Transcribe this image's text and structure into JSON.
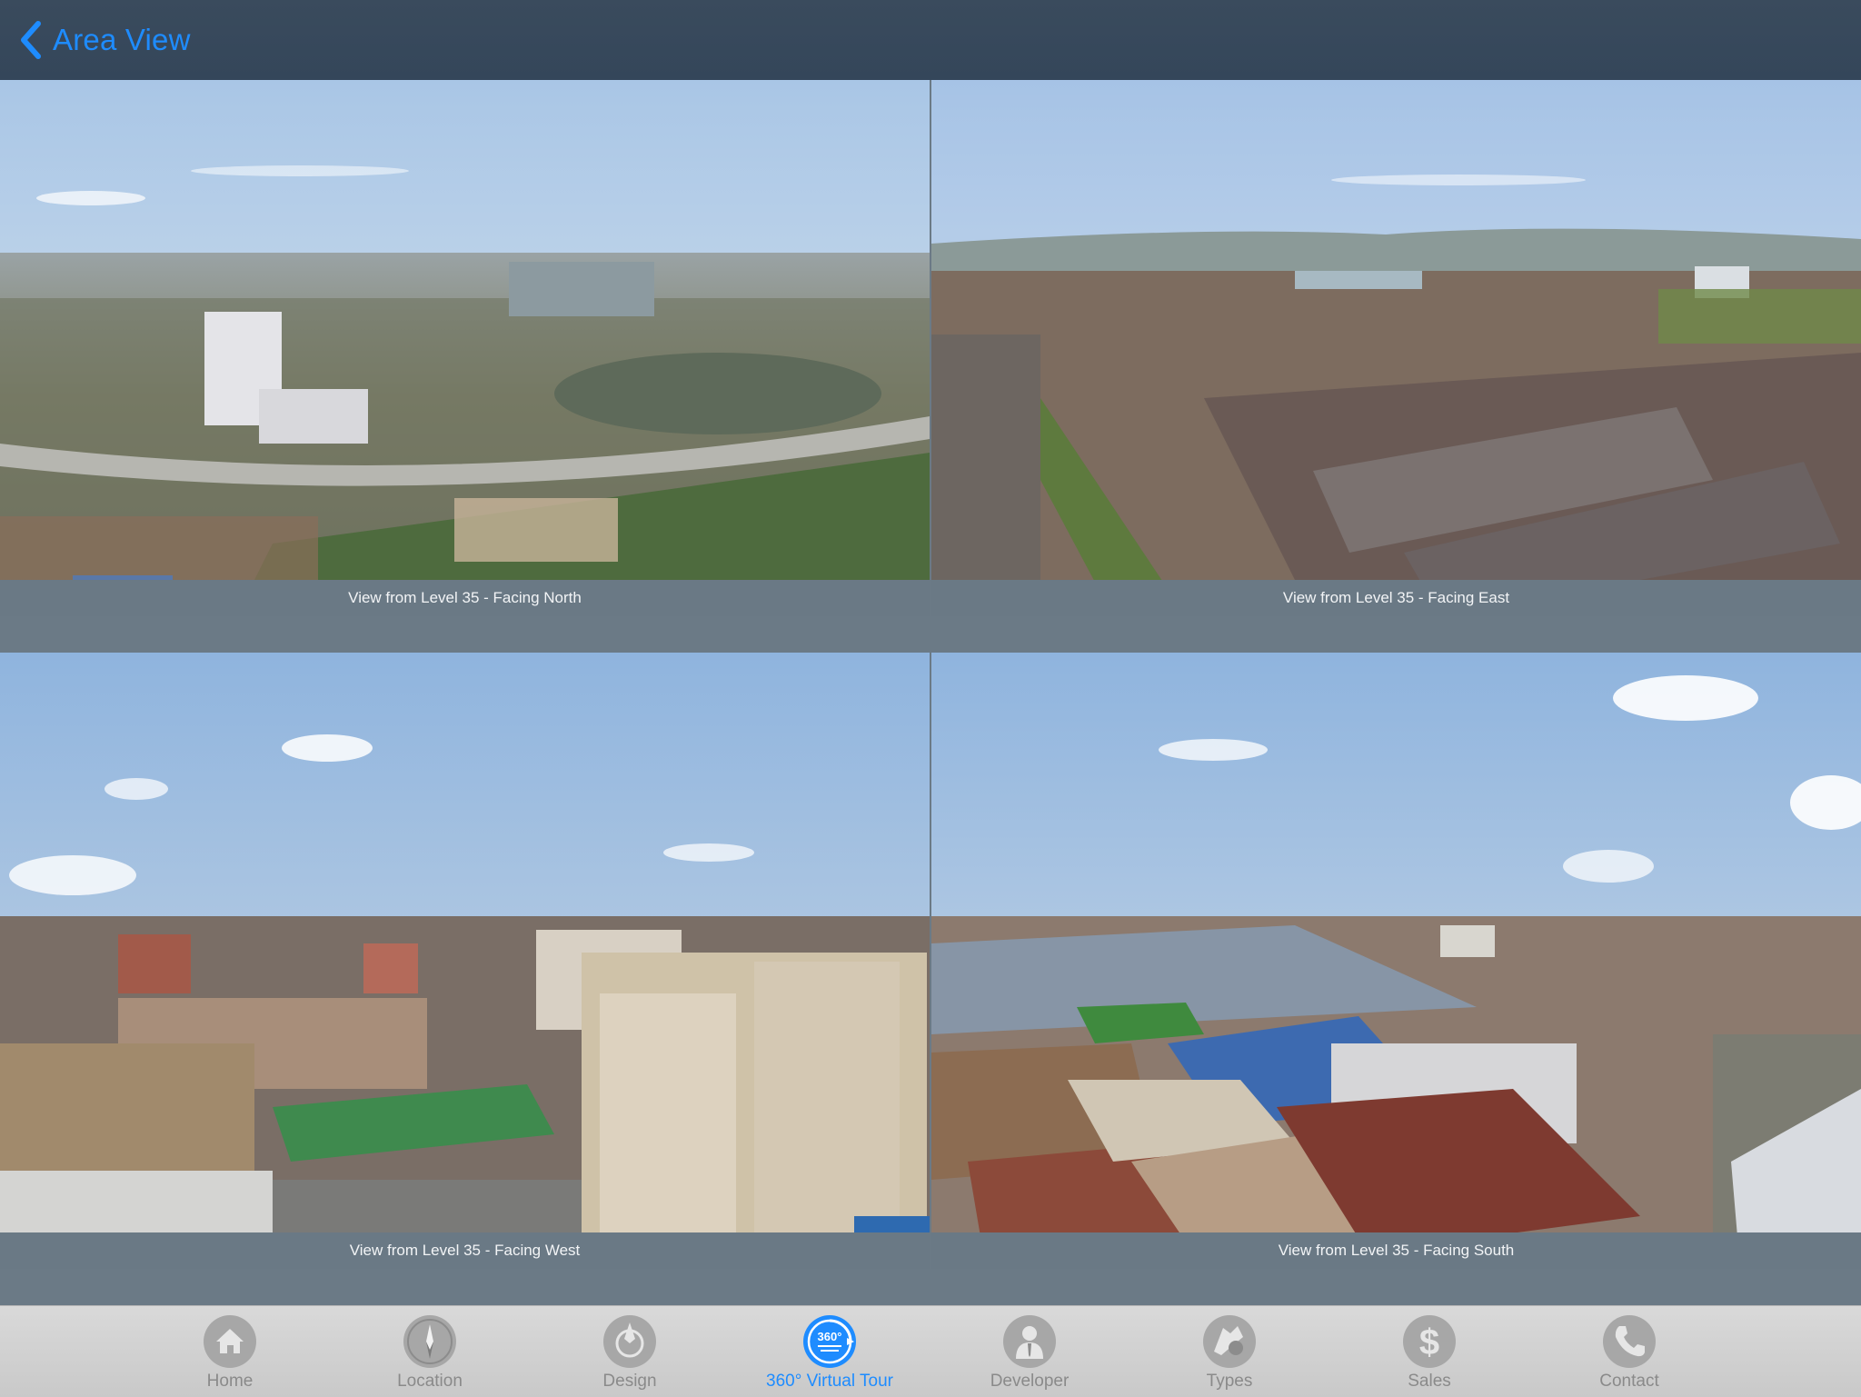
{
  "navbar": {
    "back_label": "Area View"
  },
  "views": [
    {
      "caption": "View from Level 35 - Facing North"
    },
    {
      "caption": "View from Level 35 - Facing East"
    },
    {
      "caption": "View from Level 35 - Facing West"
    },
    {
      "caption": "View from Level 35 - Facing South"
    }
  ],
  "tabs": [
    {
      "label": "Home",
      "icon": "home-icon"
    },
    {
      "label": "Location",
      "icon": "location-icon"
    },
    {
      "label": "Design",
      "icon": "design-icon"
    },
    {
      "label": "360° Virtual Tour",
      "icon": "360-virtual-tour-icon",
      "badge": "360°"
    },
    {
      "label": "Developer",
      "icon": "developer-icon"
    },
    {
      "label": "Types",
      "icon": "types-icon"
    },
    {
      "label": "Sales",
      "icon": "sales-icon",
      "glyph": "$"
    },
    {
      "label": "Contact",
      "icon": "contact-icon"
    }
  ],
  "active_tab": "360° Virtual Tour",
  "colors": {
    "accent": "#1e8cff",
    "navbar": "#37495c",
    "caption_bar": "#6a7985",
    "tabbar": "#d2d2d2"
  }
}
